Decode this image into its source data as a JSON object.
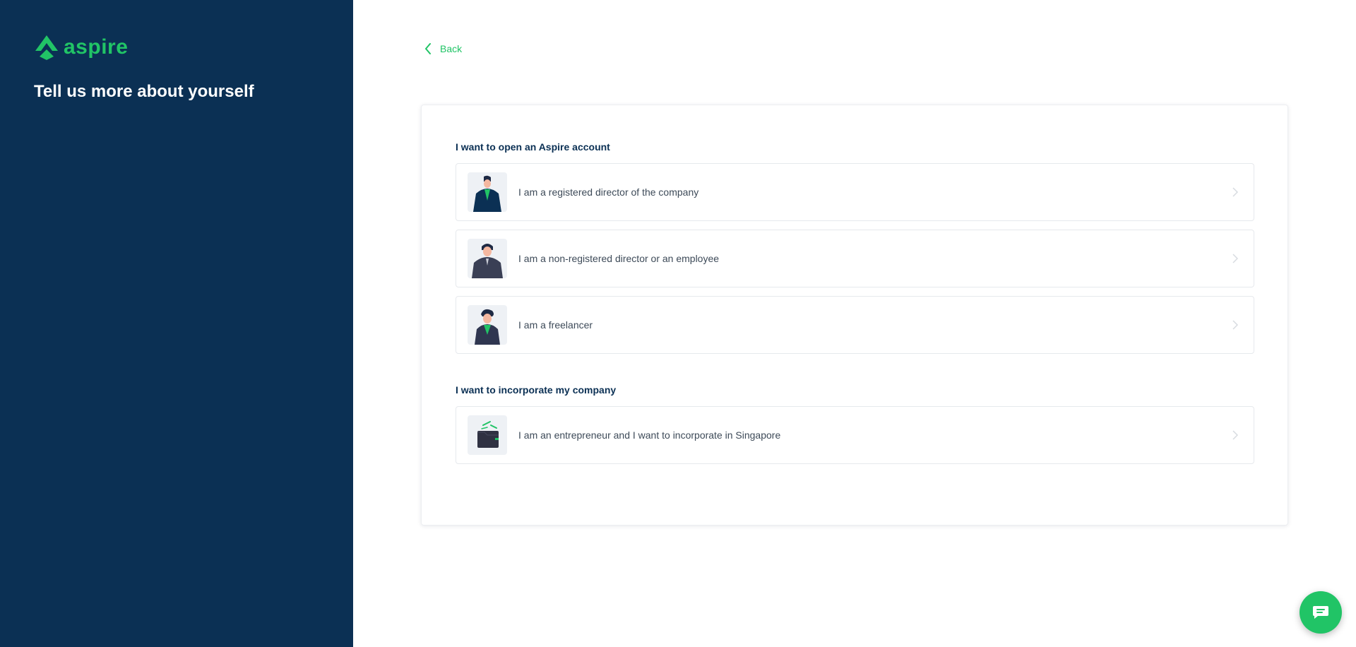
{
  "brand": {
    "name": "aspire",
    "color": "#21c466"
  },
  "sidebar": {
    "title": "Tell us more about yourself",
    "background": "#0b3054"
  },
  "back": {
    "label": "Back"
  },
  "sections": [
    {
      "heading": "I want to open an Aspire account",
      "options": [
        {
          "label": "I am a registered director of the company",
          "icon": "registered-director-avatar-icon"
        },
        {
          "label": "I am a non-registered director or an employee",
          "icon": "employee-avatar-icon"
        },
        {
          "label": "I am a freelancer",
          "icon": "freelancer-avatar-icon"
        }
      ]
    },
    {
      "heading": "I want to incorporate my company",
      "options": [
        {
          "label": "I am an entrepreneur and I want to incorporate in Singapore",
          "icon": "incorporate-wallet-icon"
        }
      ]
    }
  ],
  "chat": {
    "icon": "chat-icon"
  }
}
